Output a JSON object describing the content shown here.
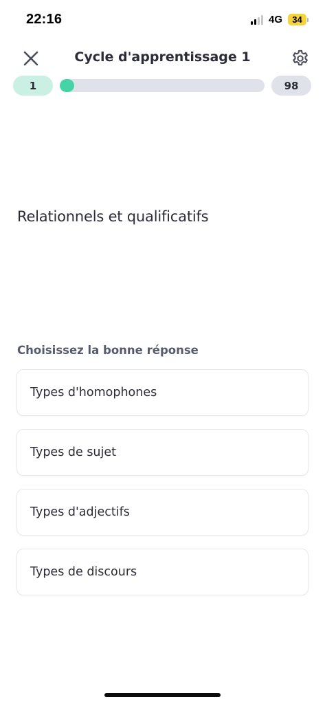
{
  "status_bar": {
    "time": "22:16",
    "network": "4G",
    "battery": "34",
    "signal_bars_active": 2,
    "signal_bars_total": 4
  },
  "header": {
    "title": "Cycle d'apprentissage 1",
    "close_icon": "close-icon",
    "settings_icon": "gear-icon"
  },
  "progress": {
    "current": "1",
    "total": "98",
    "fraction": 0.0102,
    "fill_color": "#45d4a5",
    "track_color": "#dfe2e8"
  },
  "prompt": {
    "text": "Relationnels et qualificatifs"
  },
  "question": {
    "instruction": "Choisissez la bonne réponse",
    "options": [
      {
        "label": "Types d'homophones"
      },
      {
        "label": "Types de sujet"
      },
      {
        "label": "Types d'adjectifs"
      },
      {
        "label": "Types de discours"
      }
    ]
  },
  "colors": {
    "accent": "#45d4a5",
    "accent_light": "#c9f0e3",
    "text": "#2c2c38",
    "muted_text": "#555a6d"
  }
}
